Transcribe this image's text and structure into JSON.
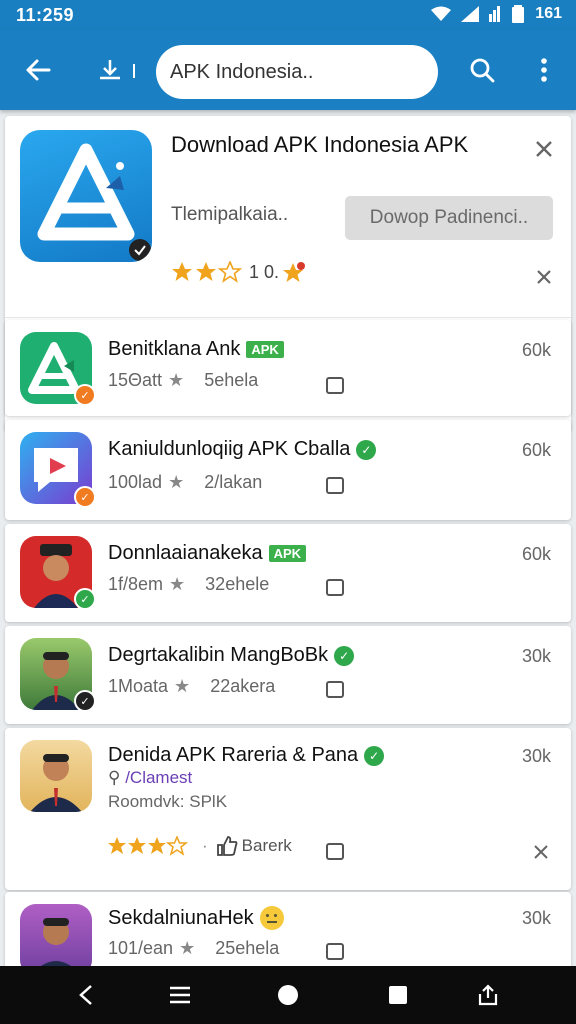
{
  "status_bar": {
    "time": "11:259",
    "battery_text": "161"
  },
  "app_bar": {
    "search_text": "APK Indonesia.."
  },
  "featured": {
    "title": "Download APK Indonesia APK",
    "subtitle": "Tlemipalkaia..",
    "download_label": "Dowop Padinenci..",
    "rating_text": "1 0."
  },
  "apps": [
    {
      "name": "Benitklana Ank",
      "tag": "APK",
      "tag_type": "label",
      "downloads": "15Θatt",
      "meta2": "5ehela",
      "size": "60k"
    },
    {
      "name": "Kaniuldunloqiig APK Cballa",
      "tag": "",
      "tag_type": "dot",
      "downloads": "100lad",
      "meta2": "2/lakan",
      "size": "60k"
    },
    {
      "name": "Donnlaaianakeka",
      "tag": "APK",
      "tag_type": "label",
      "downloads": "1f/8em",
      "meta2": "32ehele",
      "size": "60k"
    },
    {
      "name": "Degrtakalibin MangBoBk",
      "tag": "",
      "tag_type": "dot",
      "downloads": "1Moata",
      "meta2": "22akera",
      "size": "30k"
    },
    {
      "name": "Denida APK Rareria & Pana",
      "tag": "",
      "tag_type": "dot",
      "link": "/Clamest",
      "desc": "Roomdvk: SPlK",
      "action_label": "Barerk",
      "size": "30k"
    },
    {
      "name": "SekdalniunaHek",
      "tag": "",
      "tag_type": "emoji",
      "downloads": "101/ean",
      "meta2": "25ehela",
      "size": "30k"
    }
  ],
  "colors": {
    "app_bar": "#1a80c3",
    "accent_green": "#3cb04a",
    "link_purple": "#6b3fb5",
    "star": "#f0a31c"
  }
}
